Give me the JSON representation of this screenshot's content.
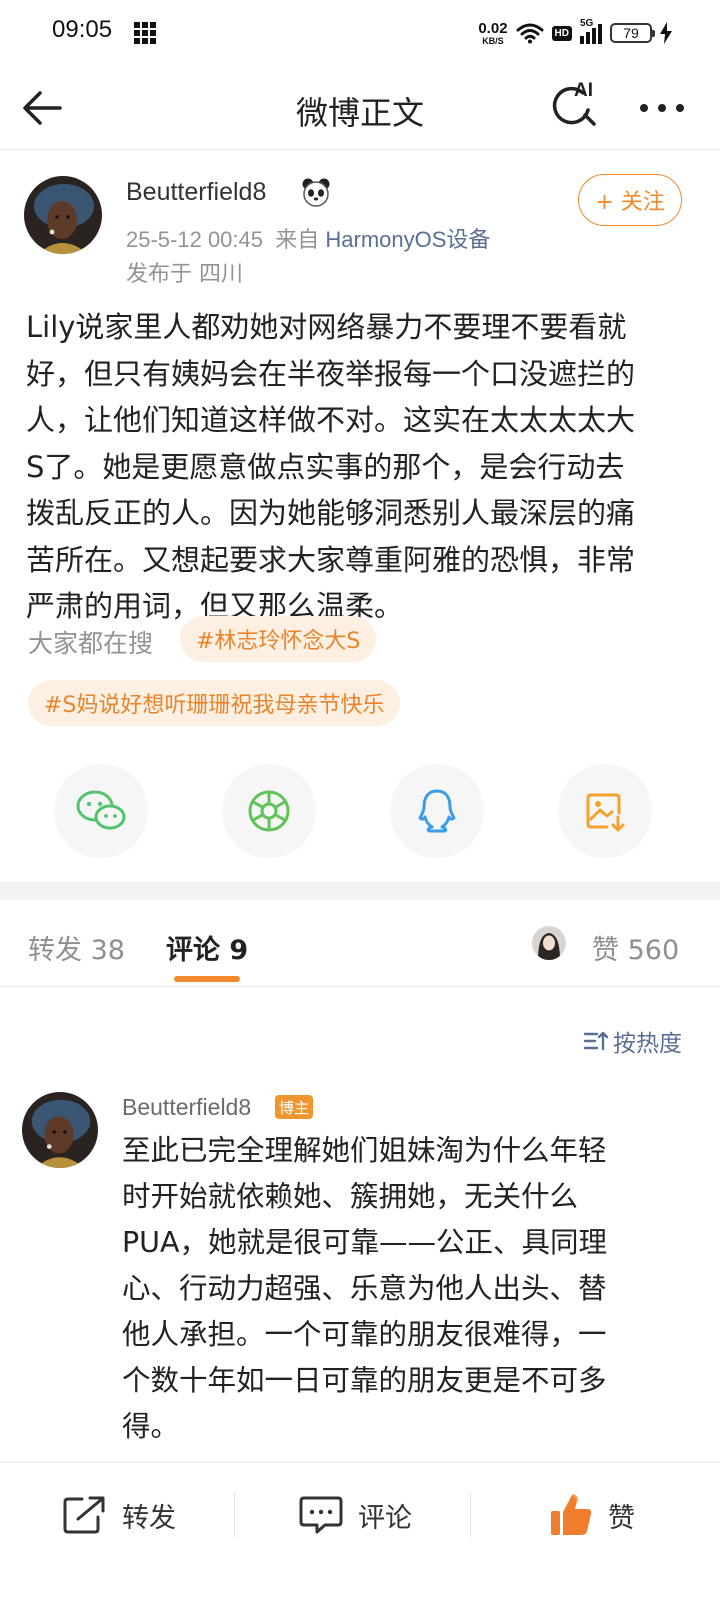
{
  "status_bar": {
    "time": "09:05",
    "net_speed_value": "0.02",
    "net_speed_unit": "KB/S",
    "hd_label": "HD",
    "signal_label": "5G",
    "battery": "79"
  },
  "nav": {
    "title": "微博正文",
    "ai_label": "AI"
  },
  "post": {
    "author": "Beutterfield8",
    "date": "25-5-12 00:45",
    "source_prefix": "来自",
    "source": "HarmonyOS设备",
    "location": "发布于 四川",
    "follow_label": "+ 关注",
    "lines": [
      "Lily说家里人都劝她对网络暴力不要理不要看就",
      "好，但只有姨妈会在半夜举报每一个口没遮拦的",
      "人，让他们知道这样做不对。这实在太太太太大",
      "S了。她是更愿意做点实事的那个，是会行动去",
      "拨乱反正的人。因为她能够洞悉别人最深层的痛",
      "苦所在。又想起要求大家尊重阿雅的恐惧，非常",
      "严肃的用词，但又那么温柔。"
    ]
  },
  "hot_search": {
    "label": "大家都在搜",
    "tags": [
      "#林志玲怀念大S",
      "#S妈说好想听珊珊祝我母亲节快乐"
    ]
  },
  "tabs": {
    "repost": "转发 38",
    "comment": "评论 9",
    "likes": "赞 560"
  },
  "sort_label": "按热度",
  "comment": {
    "author": "Beutterfield8",
    "badge": "博主",
    "lines": [
      "至此已完全理解她们姐妹淘为什么年轻",
      "时开始就依赖她、簇拥她，无关什么",
      "PUA，她就是很可靠——公正、具同理",
      "心、行动力超强、乐意为他人出头、替",
      "他人承担。一个可靠的朋友很难得，一",
      "个数十年如一日可靠的朋友更是不可多",
      "得。"
    ]
  },
  "bottom_bar": {
    "repost": "转发",
    "comment": "评论",
    "like": "赞"
  },
  "colors": {
    "accent": "#f18a2c",
    "link": "#5a6f94",
    "tag_bg": "#fdf0e3",
    "wechat": "#52c46e",
    "moments": "#62c25a",
    "qq": "#3a9be8",
    "save": "#f2a32e"
  },
  "icons": [
    "back-arrow-icon",
    "ai-search-icon",
    "more-icon",
    "panda-icon",
    "wechat-icon",
    "moments-icon",
    "qq-icon",
    "save-image-icon",
    "sort-icon",
    "repost-icon",
    "comment-icon",
    "like-icon"
  ]
}
